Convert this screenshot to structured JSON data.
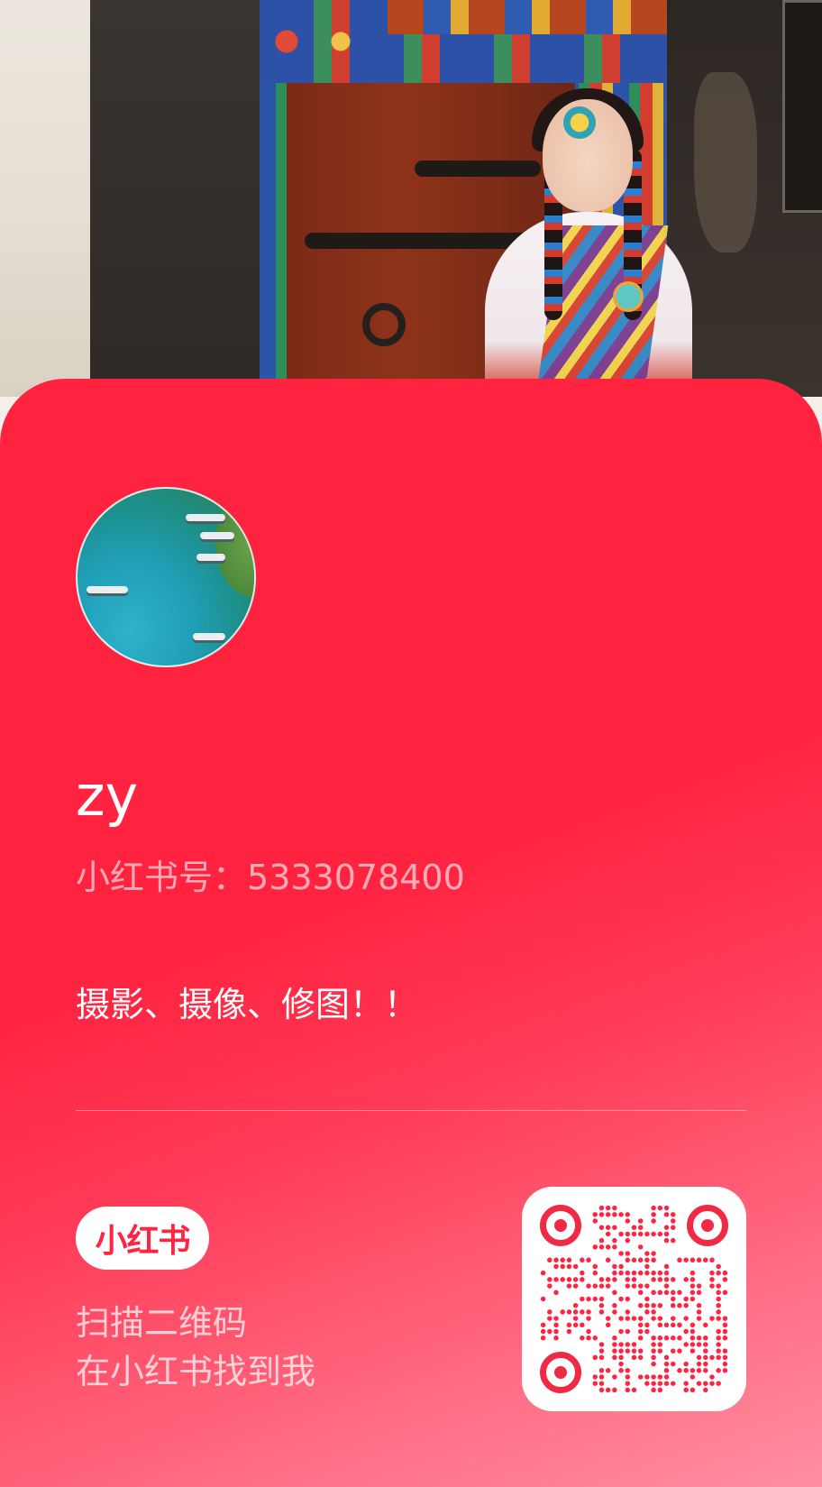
{
  "profile": {
    "username": "zy",
    "id_label": "小红书号：",
    "id_value": "5333078400",
    "bio": "摄影、摄像、修图！！"
  },
  "footer": {
    "logo_text": "小红书",
    "scan_line1": "扫描二维码",
    "scan_line2": "在小红书找到我"
  },
  "colors": {
    "brand_red": "#ff2442",
    "card_red": "#ff2340",
    "white": "#ffffff"
  },
  "icons": {
    "avatar": "avatar-image",
    "qr": "qr-code"
  }
}
